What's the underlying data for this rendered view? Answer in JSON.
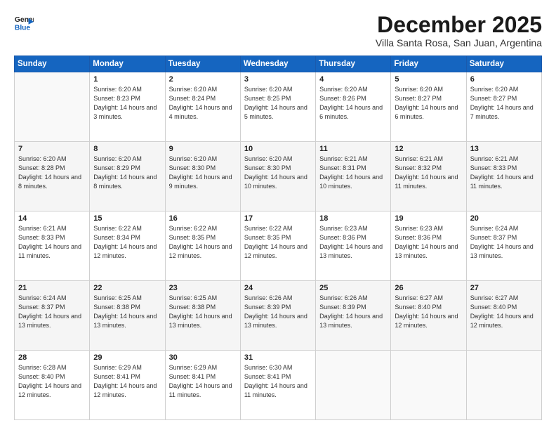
{
  "logo": {
    "line1": "General",
    "line2": "Blue"
  },
  "title": "December 2025",
  "subtitle": "Villa Santa Rosa, San Juan, Argentina",
  "days_header": [
    "Sunday",
    "Monday",
    "Tuesday",
    "Wednesday",
    "Thursday",
    "Friday",
    "Saturday"
  ],
  "weeks": [
    [
      {
        "num": "",
        "sunrise": "",
        "sunset": "",
        "daylight": ""
      },
      {
        "num": "1",
        "sunrise": "Sunrise: 6:20 AM",
        "sunset": "Sunset: 8:23 PM",
        "daylight": "Daylight: 14 hours and 3 minutes."
      },
      {
        "num": "2",
        "sunrise": "Sunrise: 6:20 AM",
        "sunset": "Sunset: 8:24 PM",
        "daylight": "Daylight: 14 hours and 4 minutes."
      },
      {
        "num": "3",
        "sunrise": "Sunrise: 6:20 AM",
        "sunset": "Sunset: 8:25 PM",
        "daylight": "Daylight: 14 hours and 5 minutes."
      },
      {
        "num": "4",
        "sunrise": "Sunrise: 6:20 AM",
        "sunset": "Sunset: 8:26 PM",
        "daylight": "Daylight: 14 hours and 6 minutes."
      },
      {
        "num": "5",
        "sunrise": "Sunrise: 6:20 AM",
        "sunset": "Sunset: 8:27 PM",
        "daylight": "Daylight: 14 hours and 6 minutes."
      },
      {
        "num": "6",
        "sunrise": "Sunrise: 6:20 AM",
        "sunset": "Sunset: 8:27 PM",
        "daylight": "Daylight: 14 hours and 7 minutes."
      }
    ],
    [
      {
        "num": "7",
        "sunrise": "Sunrise: 6:20 AM",
        "sunset": "Sunset: 8:28 PM",
        "daylight": "Daylight: 14 hours and 8 minutes."
      },
      {
        "num": "8",
        "sunrise": "Sunrise: 6:20 AM",
        "sunset": "Sunset: 8:29 PM",
        "daylight": "Daylight: 14 hours and 8 minutes."
      },
      {
        "num": "9",
        "sunrise": "Sunrise: 6:20 AM",
        "sunset": "Sunset: 8:30 PM",
        "daylight": "Daylight: 14 hours and 9 minutes."
      },
      {
        "num": "10",
        "sunrise": "Sunrise: 6:20 AM",
        "sunset": "Sunset: 8:30 PM",
        "daylight": "Daylight: 14 hours and 10 minutes."
      },
      {
        "num": "11",
        "sunrise": "Sunrise: 6:21 AM",
        "sunset": "Sunset: 8:31 PM",
        "daylight": "Daylight: 14 hours and 10 minutes."
      },
      {
        "num": "12",
        "sunrise": "Sunrise: 6:21 AM",
        "sunset": "Sunset: 8:32 PM",
        "daylight": "Daylight: 14 hours and 11 minutes."
      },
      {
        "num": "13",
        "sunrise": "Sunrise: 6:21 AM",
        "sunset": "Sunset: 8:33 PM",
        "daylight": "Daylight: 14 hours and 11 minutes."
      }
    ],
    [
      {
        "num": "14",
        "sunrise": "Sunrise: 6:21 AM",
        "sunset": "Sunset: 8:33 PM",
        "daylight": "Daylight: 14 hours and 11 minutes."
      },
      {
        "num": "15",
        "sunrise": "Sunrise: 6:22 AM",
        "sunset": "Sunset: 8:34 PM",
        "daylight": "Daylight: 14 hours and 12 minutes."
      },
      {
        "num": "16",
        "sunrise": "Sunrise: 6:22 AM",
        "sunset": "Sunset: 8:35 PM",
        "daylight": "Daylight: 14 hours and 12 minutes."
      },
      {
        "num": "17",
        "sunrise": "Sunrise: 6:22 AM",
        "sunset": "Sunset: 8:35 PM",
        "daylight": "Daylight: 14 hours and 12 minutes."
      },
      {
        "num": "18",
        "sunrise": "Sunrise: 6:23 AM",
        "sunset": "Sunset: 8:36 PM",
        "daylight": "Daylight: 14 hours and 13 minutes."
      },
      {
        "num": "19",
        "sunrise": "Sunrise: 6:23 AM",
        "sunset": "Sunset: 8:36 PM",
        "daylight": "Daylight: 14 hours and 13 minutes."
      },
      {
        "num": "20",
        "sunrise": "Sunrise: 6:24 AM",
        "sunset": "Sunset: 8:37 PM",
        "daylight": "Daylight: 14 hours and 13 minutes."
      }
    ],
    [
      {
        "num": "21",
        "sunrise": "Sunrise: 6:24 AM",
        "sunset": "Sunset: 8:37 PM",
        "daylight": "Daylight: 14 hours and 13 minutes."
      },
      {
        "num": "22",
        "sunrise": "Sunrise: 6:25 AM",
        "sunset": "Sunset: 8:38 PM",
        "daylight": "Daylight: 14 hours and 13 minutes."
      },
      {
        "num": "23",
        "sunrise": "Sunrise: 6:25 AM",
        "sunset": "Sunset: 8:38 PM",
        "daylight": "Daylight: 14 hours and 13 minutes."
      },
      {
        "num": "24",
        "sunrise": "Sunrise: 6:26 AM",
        "sunset": "Sunset: 8:39 PM",
        "daylight": "Daylight: 14 hours and 13 minutes."
      },
      {
        "num": "25",
        "sunrise": "Sunrise: 6:26 AM",
        "sunset": "Sunset: 8:39 PM",
        "daylight": "Daylight: 14 hours and 13 minutes."
      },
      {
        "num": "26",
        "sunrise": "Sunrise: 6:27 AM",
        "sunset": "Sunset: 8:40 PM",
        "daylight": "Daylight: 14 hours and 12 minutes."
      },
      {
        "num": "27",
        "sunrise": "Sunrise: 6:27 AM",
        "sunset": "Sunset: 8:40 PM",
        "daylight": "Daylight: 14 hours and 12 minutes."
      }
    ],
    [
      {
        "num": "28",
        "sunrise": "Sunrise: 6:28 AM",
        "sunset": "Sunset: 8:40 PM",
        "daylight": "Daylight: 14 hours and 12 minutes."
      },
      {
        "num": "29",
        "sunrise": "Sunrise: 6:29 AM",
        "sunset": "Sunset: 8:41 PM",
        "daylight": "Daylight: 14 hours and 12 minutes."
      },
      {
        "num": "30",
        "sunrise": "Sunrise: 6:29 AM",
        "sunset": "Sunset: 8:41 PM",
        "daylight": "Daylight: 14 hours and 11 minutes."
      },
      {
        "num": "31",
        "sunrise": "Sunrise: 6:30 AM",
        "sunset": "Sunset: 8:41 PM",
        "daylight": "Daylight: 14 hours and 11 minutes."
      },
      {
        "num": "",
        "sunrise": "",
        "sunset": "",
        "daylight": ""
      },
      {
        "num": "",
        "sunrise": "",
        "sunset": "",
        "daylight": ""
      },
      {
        "num": "",
        "sunrise": "",
        "sunset": "",
        "daylight": ""
      }
    ]
  ]
}
